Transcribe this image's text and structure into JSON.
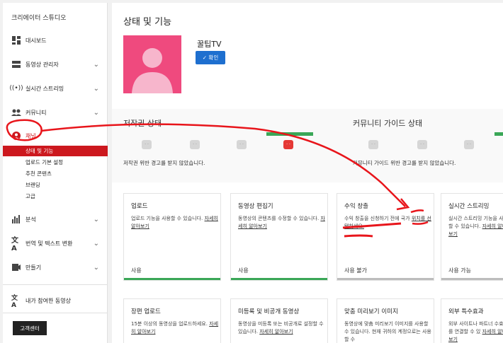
{
  "sidebar": {
    "title": "크리에이터 스튜디오",
    "items": [
      {
        "label": "대시보드",
        "icon": "dashboard-icon",
        "chevron": false
      },
      {
        "label": "동영상 관리자",
        "icon": "video-manager-icon",
        "chevron": true
      },
      {
        "label": "실시간 스트리밍",
        "icon": "live-stream-icon",
        "chevron": true
      },
      {
        "label": "커뮤니티",
        "icon": "community-icon",
        "chevron": true
      },
      {
        "label": "채널",
        "icon": "channel-icon",
        "chevron": false
      }
    ],
    "subitems": [
      "상태 및 기능",
      "업로드 기본 설정",
      "추천 콘텐츠",
      "브랜딩",
      "고급"
    ],
    "items2": [
      {
        "label": "분석",
        "icon": "analytics-icon",
        "chevron": true
      },
      {
        "label": "번역 및 텍스트 변환",
        "icon": "translate-icon",
        "chevron": true
      },
      {
        "label": "만들기",
        "icon": "create-icon",
        "chevron": true
      }
    ],
    "contributed": {
      "label": "내가 참여한 동영상",
      "icon": "contributed-icon"
    },
    "help_button": "고객센터"
  },
  "main": {
    "title": "상태 및 기능",
    "channel_name": "꿀팁TV",
    "verify_label": "✓ 확인",
    "copyright": {
      "title": "저작권 상태",
      "desc": "저작권 위반 경고를 받지 않았습니다."
    },
    "community": {
      "title": "커뮤니티 가이드 상태",
      "desc": "커뮤니티 가이드 위반 경고를 받지 않았습니다."
    },
    "cards_row1": [
      {
        "title": "업로드",
        "desc": "업로드 기능을 사용할 수 있습니다.",
        "link": "자세히 알아보기",
        "status": "사용",
        "color": "#3aa757"
      },
      {
        "title": "동영상 편집기",
        "desc": "동영상의 콘텐츠를 수정할 수 있습니다.",
        "link": "자세히 알아보기",
        "status": "사용",
        "color": "#3aa757"
      },
      {
        "title": "수익 창출",
        "desc": "수익 창출을 신청하기 전에 국가",
        "link": "위치를 선택하세요.",
        "status": "사용 불가",
        "color": "#bdbdbd"
      },
      {
        "title": "실시간 스트리밍",
        "desc": "실시간 스트리밍 기능을 사용할 수 있습니다.",
        "link": "자세히 알아보기",
        "status": "사용 가능",
        "color": "#bdbdbd"
      }
    ],
    "cards_row2": [
      {
        "title": "장편 업로드",
        "desc": "15분 이상의 동영상을 업로드하세요.",
        "link": "자세히 알아보기"
      },
      {
        "title": "미등록 및 비공개 동영상",
        "desc": "동영상을 미등록 또는 비공개로 설정할 수 있습니다.",
        "link": "자세히 알아보기"
      },
      {
        "title": "맞춤 미리보기 이미지",
        "desc": "동영상에 맞춤 미리보기 이미지를 사용할 수 있습니다. 현재 귀하의 계정으로는 사용할 수",
        "link": ""
      },
      {
        "title": "외부 특수효과",
        "desc": "외부 사이트나 파트너 수효과를 연결할 수 있",
        "link": "자세히 알아보기"
      }
    ]
  },
  "colors": {
    "accent_red": "#cc181e",
    "brand_blue": "#1e6fcf",
    "green": "#3aa757",
    "thumb_pink": "#ef4a7e",
    "annotation": "#e8151b"
  }
}
